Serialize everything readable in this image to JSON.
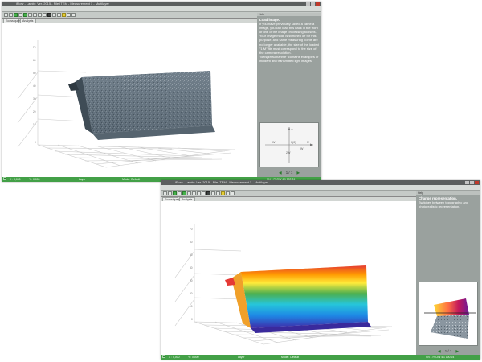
{
  "window_top": {
    "title": "iFlow - Lamb : Ver. 2015 - File ITEM - Measurement 1 - Multilayer",
    "menu": [
      "File",
      "Lens",
      "Analyze",
      "3D view",
      "Workspaces",
      "Evaluation mode",
      "Changes display mode"
    ],
    "tabs": [
      "Ecossiquen",
      "Analysis 2D"
    ],
    "panel": {
      "header": "Help",
      "heading": "Load image.",
      "body": "If you have previously saved a camera image, you can load this back in the front of one of the image processing toolsets. Your image mode is switched off for this purpose, and same measuring points are no longer available, the size of the loaded \"1 M\" file must correspond to the size of the camera resolution. \"Beispielaufnahme\" contains examples of incident and transmitted light images.",
      "page": "1 / 1"
    },
    "status": {
      "left": "X : 0,000",
      "mid": "Y : 0,000",
      "center": "Layer",
      "right": "Mode : Default",
      "far": "SN 1 FLOW 4.1 100 24"
    }
  },
  "window_bottom": {
    "title": "iFlow - Lamb : Ver. 2015 - File ITEM - Measurement 1 - Multilayer",
    "menu": [
      "File",
      "Lens",
      "Analyze",
      "3D view",
      "Workspaces",
      "Evaluation mode",
      "Changes display mode"
    ],
    "tabs": [
      "Ecossiquen",
      "Analysis 2D"
    ],
    "panel": {
      "header": "Help",
      "heading": "Change representation.",
      "body": "Switches between topographic and photorealistic representation.",
      "page": "1 / 1"
    },
    "status": {
      "left": "X : 0,000",
      "mid": "Y : 0,000",
      "center": "Layer",
      "right": "Mode : Default",
      "far": "SN 1 FLOW 4.1 100 24"
    }
  },
  "diagram_top": {
    "x_label": "X",
    "y_label": "Y",
    "origin": "0(0)",
    "w_left": "W",
    "w_right": "W",
    "w_bottom": "2W"
  },
  "colors": {
    "window_title": "#5c5f5f",
    "panel": "#9aa19e",
    "status": "#43a047",
    "surface_gray": "#5f6f7b",
    "accent_green": "#46b34a"
  },
  "icons": [
    "minimize-icon",
    "maximize-icon",
    "close-icon",
    "play-icon",
    "open-icon",
    "camera-icon",
    "zoom-icon",
    "arrow-left-icon",
    "arrow-right-icon"
  ]
}
